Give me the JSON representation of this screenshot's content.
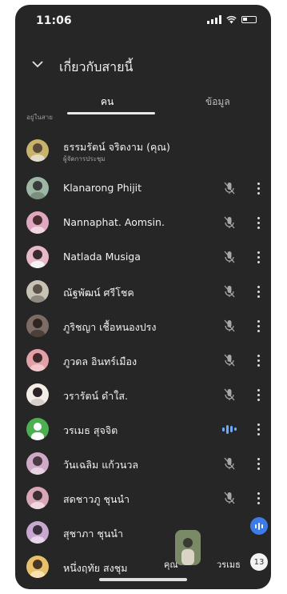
{
  "status": {
    "time": "11:06"
  },
  "header": {
    "title": "เกี่ยวกับสายนี้",
    "back_icon": "chevron-down-icon"
  },
  "tabs": [
    {
      "label": "คน",
      "active": true
    },
    {
      "label": "ข้อมูล",
      "active": false
    }
  ],
  "section_label": "อยู่ในสาย",
  "participants": [
    {
      "name": "ธรรมรัตน์ จริดงาม (คุณ)",
      "subtitle": "ผู้จัดการประชุม",
      "avatar_color": "#c9b26a",
      "mic": "none"
    },
    {
      "name": "Klanarong Phijit",
      "avatar_color": "#9db7a4",
      "mic": "muted"
    },
    {
      "name": "Nannaphat. Aomsin.",
      "avatar_color": "#e0a8c0",
      "mic": "muted"
    },
    {
      "name": "Natlada Musiga",
      "avatar_color": "#e7b9c8",
      "mic": "muted"
    },
    {
      "name": "ณัฐพัฒน์ ศรีโชค",
      "avatar_color": "#c8c2b5",
      "mic": "muted"
    },
    {
      "name": "ภูริชญา เชื้อหนองปรง",
      "avatar_color": "#7d6c63",
      "mic": "muted"
    },
    {
      "name": "ภูวดล อินทร์เมือง",
      "avatar_color": "#e3a0a8",
      "mic": "muted"
    },
    {
      "name": "วรารัตน์ ดำใส.",
      "avatar_color": "#f4ece6",
      "mic": "muted"
    },
    {
      "name": "วรเมธ สุจจิต",
      "avatar_color": "#4caf50",
      "mic": "speaking"
    },
    {
      "name": "วันเฉลิม แก้วนวล",
      "avatar_color": "#cfa9c6",
      "mic": "muted"
    },
    {
      "name": "สดชาวภู ชุนนำ",
      "avatar_color": "#d9a6b5",
      "mic": "muted"
    },
    {
      "name": "สุชาภา ชุนนำ",
      "avatar_color": "#c8a8cf",
      "mic": "none"
    },
    {
      "name": "หนึ่งฤทัย สงชุม",
      "avatar_color": "#e8c06a",
      "mic": "none"
    }
  ],
  "bottom": {
    "you_label": "คุณ",
    "self_label": "วรเมธ",
    "count": "13"
  },
  "colors": {
    "background": "#262626",
    "speaking": "#6ea8ff",
    "fab": "#3d7be8"
  }
}
